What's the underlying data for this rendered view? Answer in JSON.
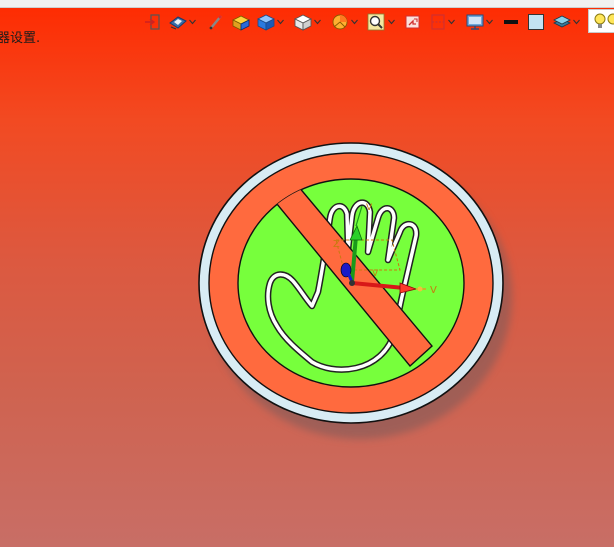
{
  "viewport": {
    "hint_text": "器设置.",
    "background_top": "#ff2a00",
    "background_bottom": "#c86e66"
  },
  "toolbar": {
    "icons": [
      "exit-icon",
      "shading-mode-icon",
      "sketch-pen-icon",
      "material-box-icon",
      "view-cube-icon",
      "standard-view-icon",
      "render-style-icon",
      "zoom-icon",
      "fit-window-icon",
      "section-view-icon",
      "display-settings-icon",
      "line-color-icon",
      "face-color-icon",
      "layer-icon",
      "light-bulb-icon"
    ]
  },
  "model": {
    "name": "prohibition-hand-sign",
    "colors": {
      "outer_rim": "#d8ecf4",
      "red_ring": "#ff6a3e",
      "green_field": "#77ff3c",
      "hand_outline": "#ffffff",
      "triad_x": "#e02020",
      "triad_y": "#20b020",
      "triad_z": "#1010c0"
    },
    "triad_labels": {
      "z": "Z",
      "v": "V"
    }
  }
}
